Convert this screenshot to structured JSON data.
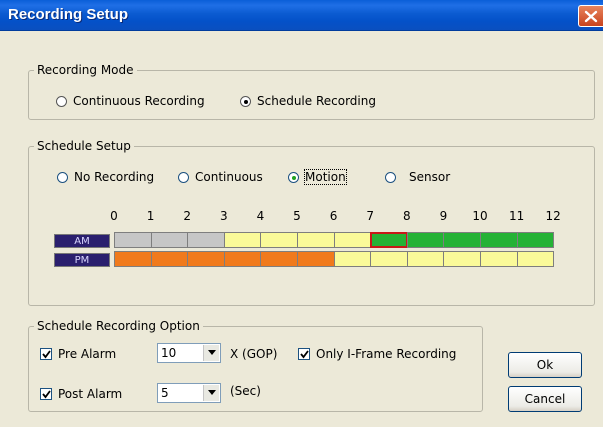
{
  "window": {
    "title": "Recording Setup"
  },
  "recording_mode": {
    "title": "Recording Mode",
    "options": [
      {
        "label": "Continuous Recording",
        "selected": false
      },
      {
        "label": "Schedule Recording",
        "selected": true
      }
    ]
  },
  "schedule_setup": {
    "title": "Schedule Setup",
    "options": [
      {
        "label": "No Recording",
        "selected": false
      },
      {
        "label": "Continuous",
        "selected": false
      },
      {
        "label": "Motion",
        "selected": true
      },
      {
        "label": "Sensor",
        "selected": false
      }
    ],
    "hours": [
      "0",
      "1",
      "2",
      "3",
      "4",
      "5",
      "6",
      "7",
      "8",
      "9",
      "10",
      "11",
      "12"
    ],
    "rows": [
      {
        "label": "AM",
        "cells": [
          "grey",
          "grey",
          "grey",
          "yellow",
          "yellow",
          "yellow",
          "yellow",
          "green",
          "green",
          "green",
          "green",
          "green"
        ]
      },
      {
        "label": "PM",
        "cells": [
          "orange",
          "orange",
          "orange",
          "orange",
          "orange",
          "orange",
          "yellow",
          "yellow",
          "yellow",
          "yellow",
          "yellow",
          "yellow"
        ]
      }
    ],
    "selected_cell": {
      "row": 0,
      "col": 7
    },
    "legend_colors": {
      "grey": "#c6c6c6",
      "yellow": "#fafa99",
      "green": "#25b235",
      "orange": "#f07a1c"
    }
  },
  "options_group": {
    "title": "Schedule Recording Option",
    "pre_alarm": {
      "label": "Pre Alarm",
      "checked": true,
      "value": "10",
      "unit": "X (GOP)"
    },
    "only_iframe": {
      "label": "Only I-Frame Recording",
      "checked": true
    },
    "post_alarm": {
      "label": "Post Alarm",
      "checked": true,
      "value": "5",
      "unit": "(Sec)"
    }
  },
  "buttons": {
    "ok": "Ok",
    "cancel": "Cancel"
  }
}
